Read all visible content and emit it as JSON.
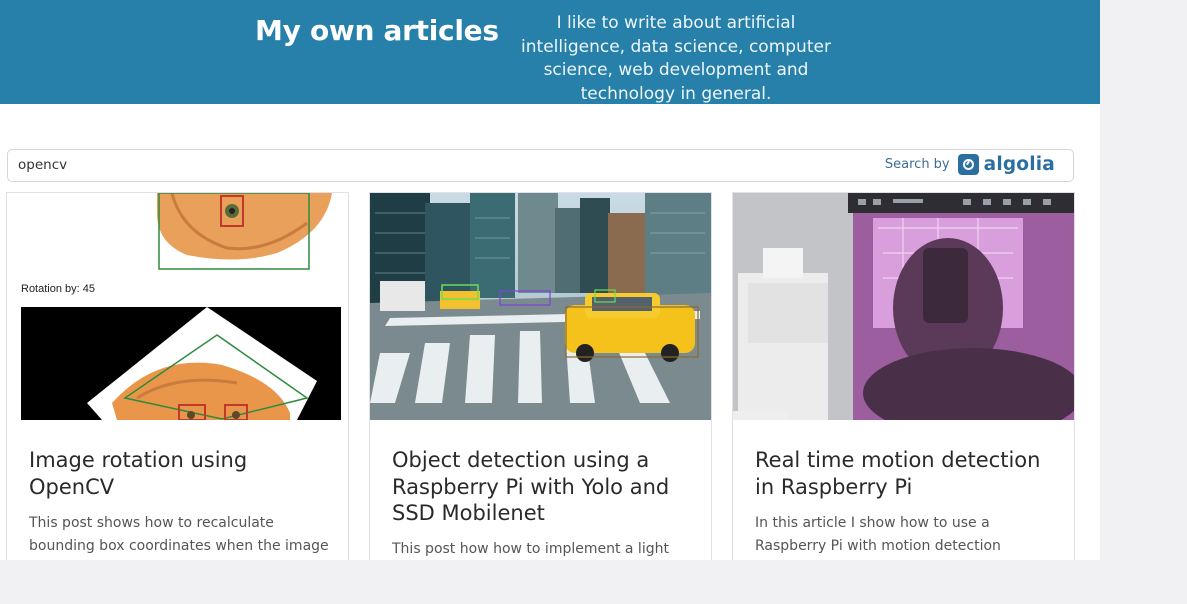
{
  "header": {
    "title": "My own articles",
    "description": "I like to write about artificial intelligence, data science, computer science, web development and technology in general."
  },
  "search": {
    "value": "opencv",
    "powered_by_label": "Search by",
    "brand": "algolia"
  },
  "articles": [
    {
      "title": "Image rotation using OpenCV",
      "excerpt": "This post shows how to recalculate bounding box coordinates when the image",
      "image_caption": "Rotation by: 45"
    },
    {
      "title": "Object detection using a Raspberry Pi with Yolo and SSD Mobilenet",
      "excerpt": "This post how how to implement a light"
    },
    {
      "title": "Real time motion detection in Raspberry Pi",
      "excerpt": "In this article I show how to use a Raspberry Pi with motion detection"
    }
  ],
  "colors": {
    "hero": "#2680a9",
    "brand_blue": "#2b6fa1"
  }
}
